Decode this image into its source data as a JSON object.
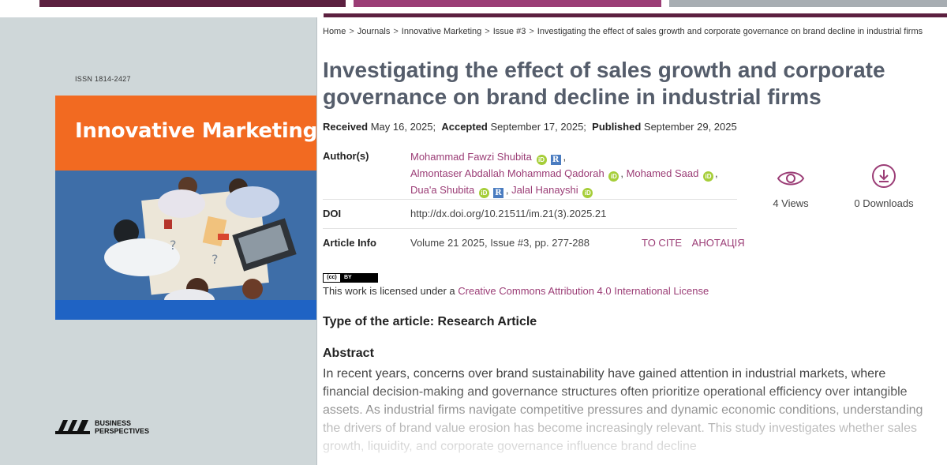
{
  "cover": {
    "issn": "ISSN 1814-2427",
    "title": "Innovative Marketing",
    "publisher_line1": "BUSINESS",
    "publisher_line2": "PERSPECTIVES"
  },
  "breadcrumb": [
    "Home",
    "Journals",
    "Innovative Marketing",
    "Issue #3",
    "Investigating the effect of sales growth and corporate governance on brand decline in industrial firms"
  ],
  "breadcrumb_sep": ">",
  "article": {
    "title": "Investigating the effect of sales growth and corporate governance on brand decline in industrial firms",
    "received_label": "Received",
    "received": "May 16, 2025;",
    "accepted_label": "Accepted",
    "accepted": "September 17, 2025;",
    "published_label": "Published",
    "published": "September 29, 2025"
  },
  "meta": {
    "authors_label": "Author(s)",
    "authors": [
      "Mohammad Fawzi Shubita",
      "Almontaser Abdallah Mohammad Qadorah",
      "Mohamed Saad",
      "Dua'a Shubita",
      "Jalal Hanayshi"
    ],
    "doi_label": "DOI",
    "doi": "http://dx.doi.org/10.21511/im.21(3).2025.21",
    "info_label": "Article Info",
    "info": "Volume 21 2025, Issue #3, pp. 277-288",
    "to_cite": "TO CITE",
    "annotation": "АНОТАЦІЯ"
  },
  "stats": {
    "views": "4 Views",
    "downloads": "0 Downloads"
  },
  "license": {
    "badge_left": "(cc)",
    "badge_right": "BY",
    "prefix": "This work is licensed under a ",
    "link": "Creative Commons Attribution 4.0 International License"
  },
  "type_of_article": "Type of the article: Research Article",
  "abstract": {
    "heading": "Abstract",
    "text": "In recent years, concerns over brand sustainability have gained attention in industrial markets, where financial decision-making and governance structures often prioritize operational efficiency over intangible assets. As industrial firms navigate competitive pressures and dynamic economic conditions, understanding the drivers of brand value erosion has become increasingly relevant. This study investigates whether sales growth, liquidity, and corporate governance influence brand decline"
  },
  "colors": {
    "accent": "#9b3d76",
    "dark_bar": "#5c2040",
    "cover_orange": "#f26a21",
    "cover_blue": "#1f63c4",
    "orcid": "#a6ce39"
  }
}
